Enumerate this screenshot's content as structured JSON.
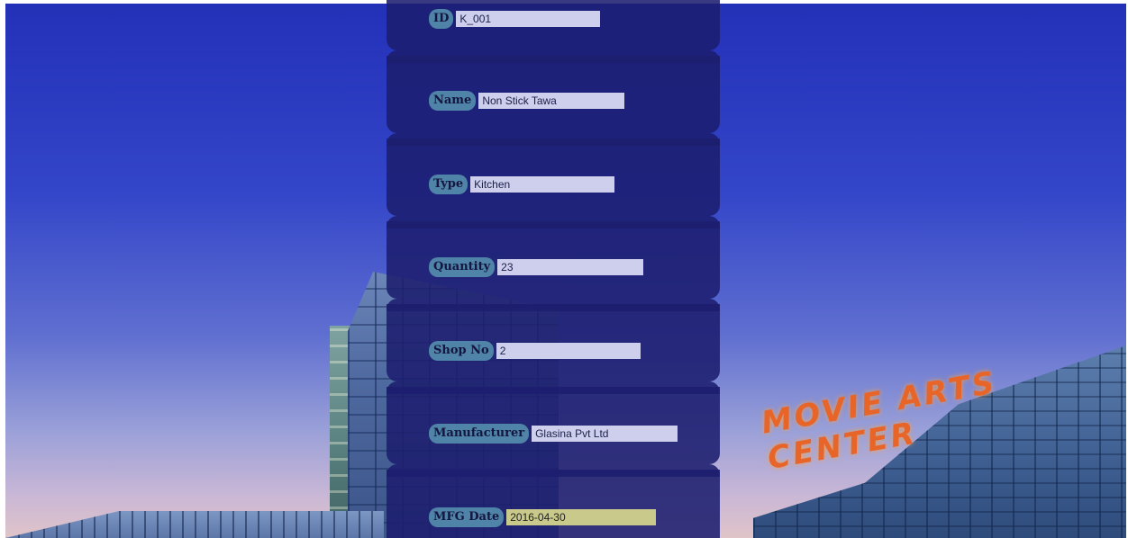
{
  "background": {
    "sign_text": "MOVIE ARTS CENTER"
  },
  "form": {
    "fields": [
      {
        "label": "ID",
        "value": "K_001"
      },
      {
        "label": "Name",
        "value": "Non Stick Tawa"
      },
      {
        "label": "Type",
        "value": "Kitchen"
      },
      {
        "label": "Quantity",
        "value": "23"
      },
      {
        "label": "Shop No",
        "value": "2"
      },
      {
        "label": "Manufacturer",
        "value": "Glasina Pvt Ltd"
      },
      {
        "label": "MFG Date",
        "value": "2016-04-30"
      }
    ]
  },
  "colors": {
    "panel": "#1c1e6e",
    "label_bg": "#4f83a7",
    "input_bg": "#cdcfec"
  }
}
